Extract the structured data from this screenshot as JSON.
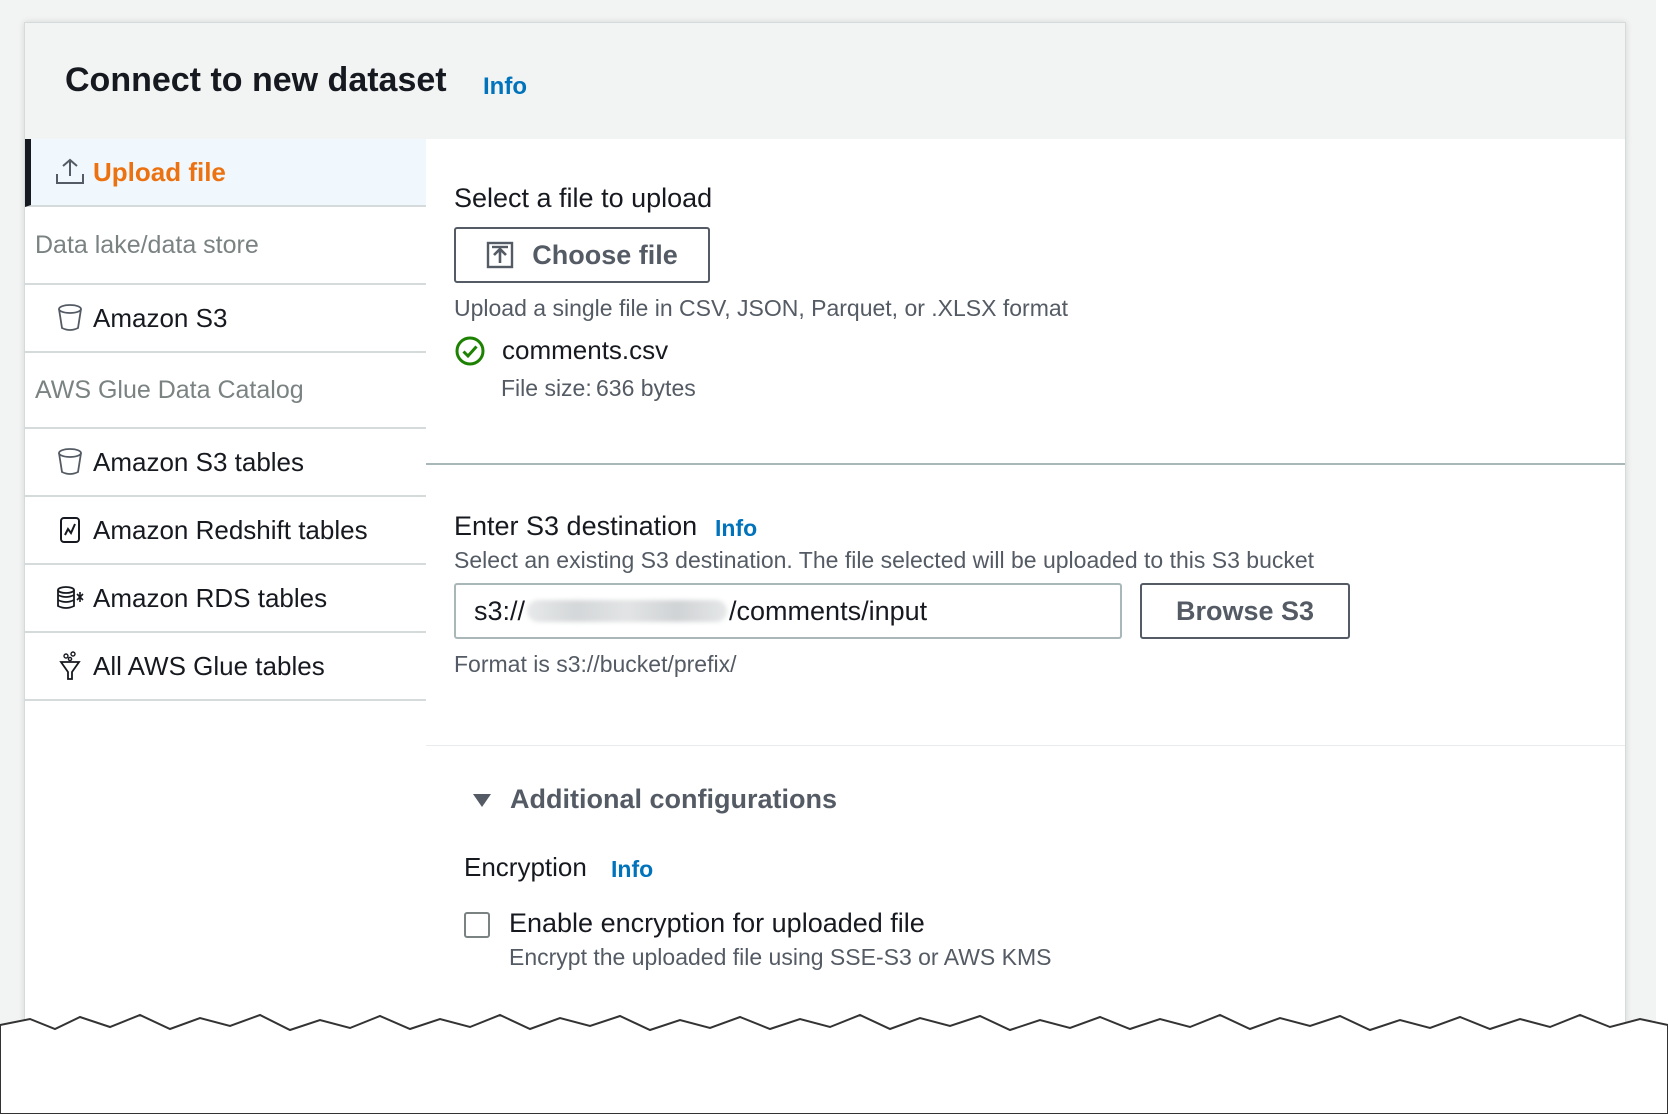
{
  "header": {
    "title": "Connect to new dataset",
    "info": "Info"
  },
  "sidebar": {
    "upload": {
      "label": "Upload file",
      "icon": "upload-icon"
    },
    "group1": "Data lake/data store",
    "s3": {
      "label": "Amazon S3",
      "icon": "bucket-icon"
    },
    "group2": "AWS Glue Data Catalog",
    "items": [
      {
        "label": "Amazon S3 tables",
        "icon": "bucket-icon"
      },
      {
        "label": "Amazon Redshift tables",
        "icon": "redshift-icon"
      },
      {
        "label": "Amazon RDS tables",
        "icon": "rds-icon"
      },
      {
        "label": "All AWS Glue tables",
        "icon": "glue-icon"
      }
    ]
  },
  "upload": {
    "label": "Select a file to upload",
    "choose_button": "Choose file",
    "hint": "Upload a single file in CSV, JSON, Parquet, or .XLSX format",
    "file_name": "comments.csv",
    "file_size_label": "File size:",
    "file_size_value": "636 bytes"
  },
  "destination": {
    "label": "Enter S3 destination",
    "info": "Info",
    "description": "Select an existing S3 destination. The file selected will be uploaded to this S3 bucket",
    "value_prefix": "s3://",
    "value_suffix": "/comments/input",
    "browse_button": "Browse S3",
    "format_hint": "Format is s3://bucket/prefix/"
  },
  "additional": {
    "title": "Additional configurations",
    "encryption_label": "Encryption",
    "encryption_info": "Info",
    "checkbox_label": "Enable encryption for uploaded file",
    "checkbox_description": "Encrypt the uploaded file using SSE-S3 or AWS KMS"
  },
  "colors": {
    "accent": "#ec7211",
    "link": "#0073bb",
    "success": "#1d8102"
  }
}
